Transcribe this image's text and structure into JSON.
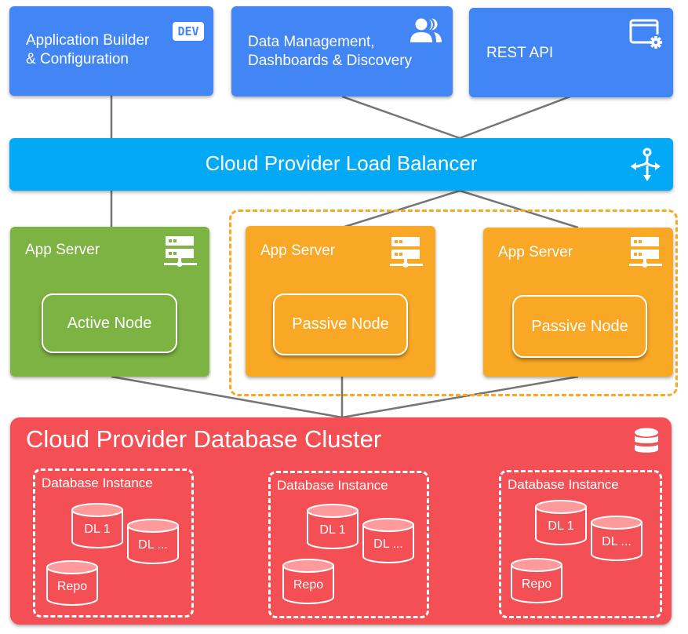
{
  "top_boxes": [
    {
      "label_line1": "Application Builder",
      "label_line2": "& Configuration",
      "icon": "dev-badge-icon",
      "badge_text": "DEV"
    },
    {
      "label_line1": "Data Management,",
      "label_line2": "Dashboards & Discovery",
      "icon": "people-icon"
    },
    {
      "label_line1": "REST API",
      "icon": "settings-window-icon"
    }
  ],
  "load_balancer": {
    "label": "Cloud Provider Load Balancer",
    "icon": "load-balancer-icon"
  },
  "app_servers": [
    {
      "label": "App Server",
      "node": "Active Node",
      "icon": "server-icon",
      "color": "#7cb342"
    },
    {
      "label": "App Server",
      "node": "Passive Node",
      "icon": "server-icon",
      "color": "#f9a825"
    },
    {
      "label": "App Server",
      "node": "Passive Node",
      "icon": "server-icon",
      "color": "#f9a825"
    }
  ],
  "database_cluster": {
    "title": "Cloud Provider Database Cluster",
    "icon": "database-icon",
    "instances": [
      {
        "label": "Database Instance",
        "stores": [
          "DL 1",
          "DL ...",
          "Repo"
        ]
      },
      {
        "label": "Database Instance",
        "stores": [
          "DL 1",
          "DL ...",
          "Repo"
        ]
      },
      {
        "label": "Database Instance",
        "stores": [
          "DL 1",
          "DL ...",
          "Repo"
        ]
      }
    ]
  },
  "colors": {
    "client_blue": "#4285f4",
    "load_balancer": "#03a9f4",
    "active": "#7cb342",
    "passive": "#f9a825",
    "database": "#f44f55",
    "connector": "#757575"
  }
}
